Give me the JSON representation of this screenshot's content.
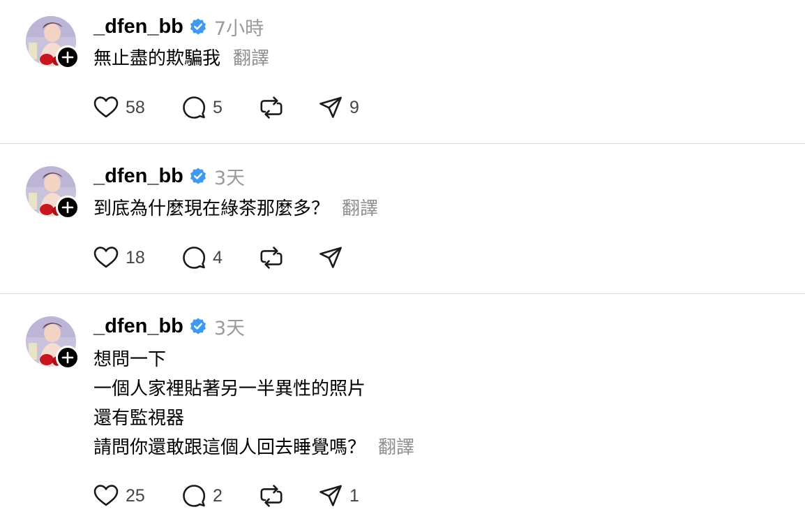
{
  "posts": [
    {
      "username": "_dfen_bb",
      "time": "7小時",
      "lines": [
        "無止盡的欺騙我"
      ],
      "translate": "翻譯",
      "likes": "58",
      "replies": "5",
      "shares": "9"
    },
    {
      "username": "_dfen_bb",
      "time": "3天",
      "lines": [
        "到底為什麼現在綠茶那麼多？"
      ],
      "translate": "翻譯",
      "likes": "18",
      "replies": "4",
      "shares": ""
    },
    {
      "username": "_dfen_bb",
      "time": "3天",
      "lines": [
        "想問一下",
        "一個人家裡貼著另一半異性的照片",
        "還有監視器",
        "請問你還敢跟這個人回去睡覺嗎？"
      ],
      "translate": "翻譯",
      "likes": "25",
      "replies": "2",
      "shares": "1"
    }
  ],
  "icons": {
    "like": "heart-icon",
    "reply": "comment-bubble-icon",
    "repost": "repost-icon",
    "share": "send-icon",
    "verified": "verified-badge-icon",
    "follow": "plus-icon"
  },
  "colors": {
    "verified_badge": "#3d9af0",
    "muted_text": "#9a9a9a",
    "divider": "#d9d9d9"
  }
}
